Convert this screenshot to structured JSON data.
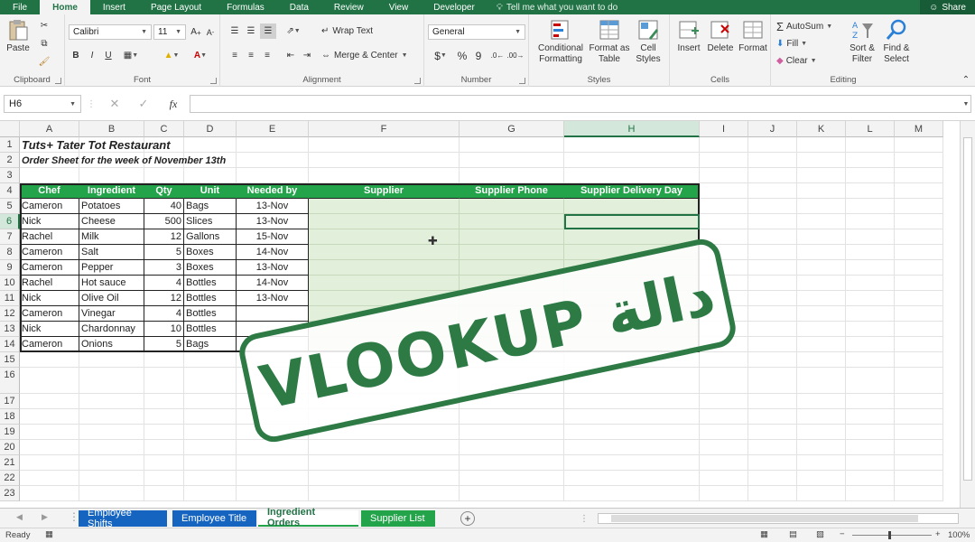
{
  "ribbon_tabs": [
    "File",
    "Home",
    "Insert",
    "Page Layout",
    "Formulas",
    "Data",
    "Review",
    "View",
    "Developer"
  ],
  "active_tab": "Home",
  "tell_me": "Tell me what you want to do",
  "share": "Share",
  "groups": {
    "clipboard": {
      "label": "Clipboard",
      "paste": "Paste"
    },
    "font": {
      "label": "Font",
      "name": "Calibri",
      "size": "11",
      "bold": "B",
      "italic": "I",
      "underline": "U"
    },
    "alignment": {
      "label": "Alignment",
      "wrap": "Wrap Text",
      "merge": "Merge & Center"
    },
    "number": {
      "label": "Number",
      "format": "General",
      "currency": "$",
      "percent": "%",
      "comma": "9"
    },
    "styles": {
      "label": "Styles",
      "conditional": "Conditional\nFormatting",
      "table": "Format as\nTable",
      "cell": "Cell\nStyles"
    },
    "cells": {
      "label": "Cells",
      "insert": "Insert",
      "delete": "Delete",
      "format": "Format"
    },
    "editing": {
      "label": "Editing",
      "autosum": "AutoSum",
      "fill": "Fill",
      "clear": "Clear",
      "sort": "Sort &\nFilter",
      "find": "Find &\nSelect"
    }
  },
  "namebox": "H6",
  "fx": "fx",
  "columns": [
    "A",
    "B",
    "C",
    "D",
    "E",
    "F",
    "G",
    "H",
    "I",
    "J",
    "K",
    "L",
    "M"
  ],
  "selected_column": "H",
  "rows": [
    "1",
    "2",
    "3",
    "4",
    "5",
    "6",
    "7",
    "8",
    "9",
    "10",
    "11",
    "12",
    "13",
    "14",
    "15",
    "16",
    "17",
    "18",
    "19",
    "20",
    "21",
    "22",
    "23"
  ],
  "selected_row": "6",
  "sheet": {
    "title": "Tuts+ Tater Tot Restaurant",
    "subtitle": "Order Sheet for the week of November 13th",
    "headers": [
      "Chef",
      "Ingredient",
      "Qty",
      "Unit",
      "Needed by",
      "Supplier",
      "Supplier Phone",
      "Supplier Delivery Day"
    ],
    "data": [
      [
        "Cameron",
        "Potatoes",
        "40",
        "Bags",
        "13-Nov"
      ],
      [
        "Nick",
        "Cheese",
        "500",
        "Slices",
        "13-Nov"
      ],
      [
        "Rachel",
        "Milk",
        "12",
        "Gallons",
        "15-Nov"
      ],
      [
        "Cameron",
        "Salt",
        "5",
        "Boxes",
        "14-Nov"
      ],
      [
        "Cameron",
        "Pepper",
        "3",
        "Boxes",
        "13-Nov"
      ],
      [
        "Rachel",
        "Hot sauce",
        "4",
        "Bottles",
        "14-Nov"
      ],
      [
        "Nick",
        "Olive Oil",
        "12",
        "Bottles",
        "13-Nov"
      ],
      [
        "Cameron",
        "Vinegar",
        "4",
        "Bottles",
        ""
      ],
      [
        "Nick",
        "Chardonnay",
        "10",
        "Bottles",
        ""
      ],
      [
        "Cameron",
        "Onions",
        "5",
        "Bags",
        ""
      ]
    ]
  },
  "stamp": {
    "latin": "VLOOKUP",
    "arabic": "دالة"
  },
  "sheet_tabs": [
    {
      "label": "Employee Shifts",
      "color": "#1565c0"
    },
    {
      "label": "Employee Title",
      "color": "#1565c0"
    },
    {
      "label": "Ingredient Orders",
      "color": "#ffffff"
    },
    {
      "label": "Supplier List",
      "color": "#23a34a"
    }
  ],
  "active_sheet": "Ingredient Orders",
  "status": {
    "ready": "Ready",
    "zoom": "100%"
  },
  "colors": {
    "accent": "#217346",
    "header_fill": "#23a34a",
    "light_fill": "#e2efda"
  }
}
